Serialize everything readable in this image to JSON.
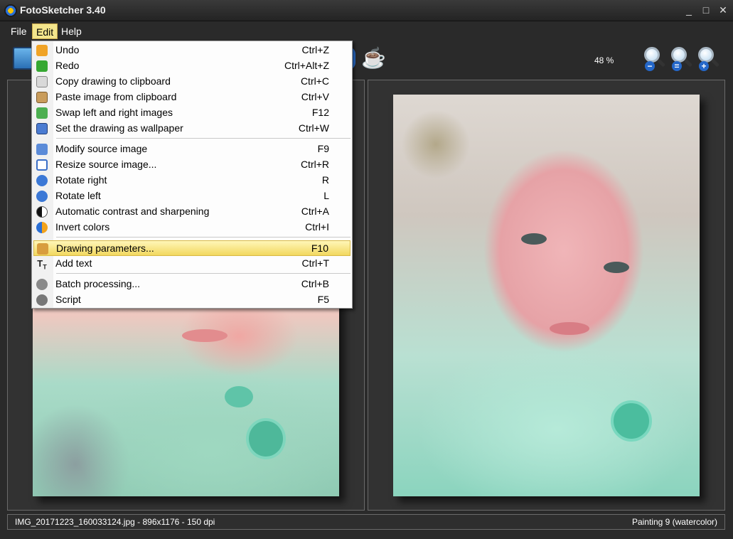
{
  "window": {
    "title": "FotoSketcher 3.40",
    "minimize": "_",
    "maximize": "□",
    "close": "✕"
  },
  "menubar": {
    "items": [
      {
        "label": "File"
      },
      {
        "label": "Edit"
      },
      {
        "label": "Help"
      }
    ]
  },
  "toolbar": {
    "zoom_level": "48 %",
    "icons": [
      "open-icon",
      "global-view-icon",
      "coffee-icon",
      "zoom-out-icon",
      "zoom-actual-icon",
      "zoom-in-icon"
    ],
    "zoom_signs": {
      "out": "−",
      "actual": "=",
      "in": "+"
    }
  },
  "edit_menu": {
    "items": [
      {
        "label": "Undo",
        "shortcut": "Ctrl+Z",
        "icon": "undo-icon"
      },
      {
        "label": "Redo",
        "shortcut": "Ctrl+Alt+Z",
        "icon": "redo-icon"
      },
      {
        "label": "Copy drawing to clipboard",
        "shortcut": "Ctrl+C",
        "icon": "copy-icon"
      },
      {
        "label": "Paste image from clipboard",
        "shortcut": "Ctrl+V",
        "icon": "paste-icon"
      },
      {
        "label": "Swap left and right images",
        "shortcut": "F12",
        "icon": "swap-icon"
      },
      {
        "label": "Set the drawing as wallpaper",
        "shortcut": "Ctrl+W",
        "icon": "wallpaper-icon"
      },
      {
        "label": "Modify source image",
        "shortcut": "F9",
        "icon": "modify-image-icon"
      },
      {
        "label": "Resize source image...",
        "shortcut": "Ctrl+R",
        "icon": "resize-icon"
      },
      {
        "label": "Rotate right",
        "shortcut": "R",
        "icon": "rotate-right-icon"
      },
      {
        "label": "Rotate left",
        "shortcut": "L",
        "icon": "rotate-left-icon"
      },
      {
        "label": "Automatic contrast and sharpening",
        "shortcut": "Ctrl+A",
        "icon": "contrast-icon"
      },
      {
        "label": "Invert colors",
        "shortcut": "Ctrl+I",
        "icon": "invert-icon"
      },
      {
        "label": "Drawing parameters...",
        "shortcut": "F10",
        "icon": "palette-icon"
      },
      {
        "label": "Add text",
        "shortcut": "Ctrl+T",
        "icon": "text-icon"
      },
      {
        "label": "Batch processing...",
        "shortcut": "Ctrl+B",
        "icon": "batch-gear-icon"
      },
      {
        "label": "Script",
        "shortcut": "F5",
        "icon": "script-gears-icon"
      }
    ],
    "highlighted": "Drawing parameters..."
  },
  "statusbar": {
    "left": "IMG_20171223_160033124.jpg - 896x1176 - 150 dpi",
    "right": "Painting 9 (watercolor)"
  },
  "colors": {
    "background": "#2a2a2a",
    "menu_active": "#f3e58c",
    "highlight": "#f2d85f"
  }
}
